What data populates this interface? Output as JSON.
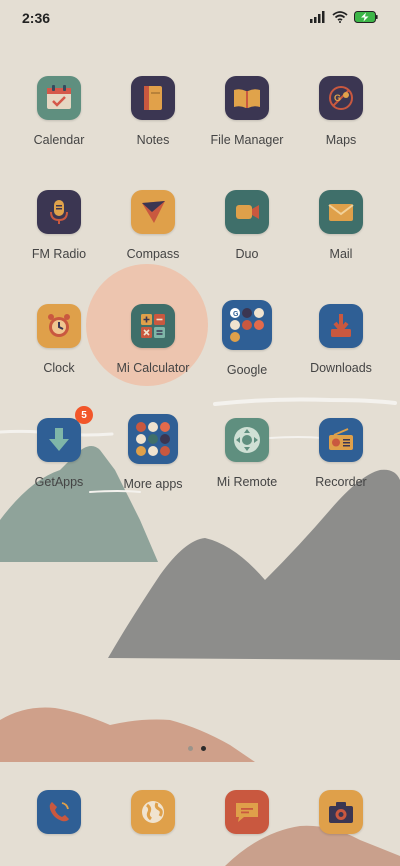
{
  "status": {
    "time": "2:36"
  },
  "apps": {
    "calendar": "Calendar",
    "notes": "Notes",
    "file_manager": "File Manager",
    "maps": "Maps",
    "fm_radio": "FM Radio",
    "compass": "Compass",
    "duo": "Duo",
    "mail": "Mail",
    "clock": "Clock",
    "mi_calculator": "Mi Calculator",
    "google": "Google",
    "downloads": "Downloads",
    "getapps": "GetApps",
    "more_apps": "More apps",
    "mi_remote": "Mi Remote",
    "recorder": "Recorder"
  },
  "badges": {
    "getapps": "5"
  },
  "pages": {
    "count": 2,
    "active": 2
  },
  "colors": {
    "background": "#e4ded3",
    "mountain_green": "#8fa39a",
    "mountain_gray": "#8d8d8b",
    "mountain_pink": "#cfa08a",
    "badge": "#f2562a"
  },
  "icons": {
    "calendar": "calendar-icon",
    "notes": "notes-icon",
    "file_manager": "folder-book-icon",
    "maps": "map-pin-icon",
    "fm_radio": "microphone-icon",
    "compass": "compass-arrow-icon",
    "duo": "video-camera-icon",
    "mail": "envelope-icon",
    "clock": "alarm-clock-icon",
    "mi_calculator": "calculator-icon",
    "google": "google-folder-icon",
    "downloads": "download-tray-icon",
    "getapps": "download-arrow-icon",
    "more_apps": "apps-folder-icon",
    "mi_remote": "remote-dpad-icon",
    "recorder": "radio-recorder-icon",
    "dock_phone": "phone-icon",
    "dock_browser": "globe-icon",
    "dock_messages": "chat-bubble-icon",
    "dock_camera": "camera-icon"
  }
}
